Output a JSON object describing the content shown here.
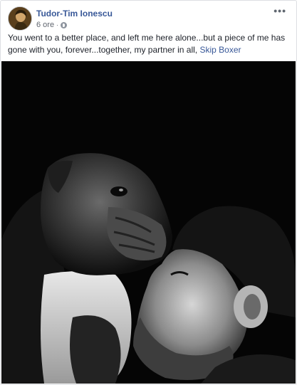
{
  "post": {
    "author": "Tudor-Tim Ionescu",
    "time": "6 ore",
    "separator": "·",
    "more_icon": "more-horizontal-icon",
    "privacy_icon": "globe-icon",
    "text_main": "You went to a better place, and left me here alone...but a piece of me has gone with you, forever...together, my partner in all, ",
    "tagged": "Skip Boxer"
  },
  "colors": {
    "link": "#385898",
    "text": "#1d2129",
    "meta": "#616770",
    "photo_bg": "#050505"
  }
}
